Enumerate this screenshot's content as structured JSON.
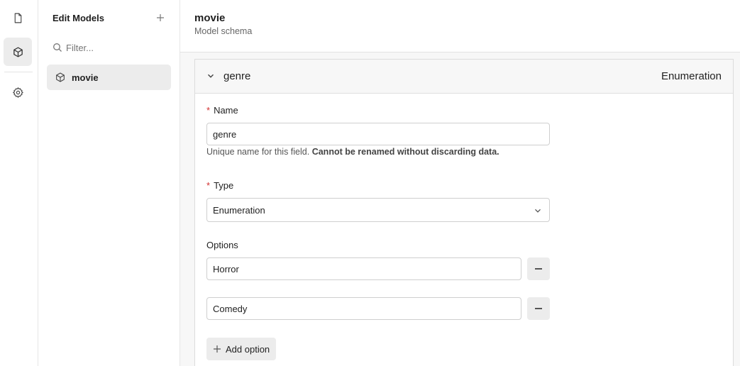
{
  "rail": {
    "items": [
      {
        "icon": "document-icon"
      },
      {
        "icon": "cube-icon",
        "active": true
      },
      {
        "icon": "gear-icon"
      }
    ]
  },
  "sidebar": {
    "title": "Edit Models",
    "filter_placeholder": "Filter...",
    "items": [
      {
        "label": "movie",
        "icon": "cube-icon",
        "selected": true
      }
    ]
  },
  "header": {
    "title": "movie",
    "subtitle": "Model schema"
  },
  "field": {
    "name": "genre",
    "type_badge": "Enumeration",
    "name_label": "Name",
    "name_value": "genre",
    "hint_text": "Unique name for this field.",
    "hint_bold": "Cannot be renamed without discarding data.",
    "type_label": "Type",
    "type_value": "Enumeration",
    "options_label": "Options",
    "options": [
      "Horror",
      "Comedy"
    ],
    "add_option_label": "Add option",
    "required_marker": "*"
  }
}
